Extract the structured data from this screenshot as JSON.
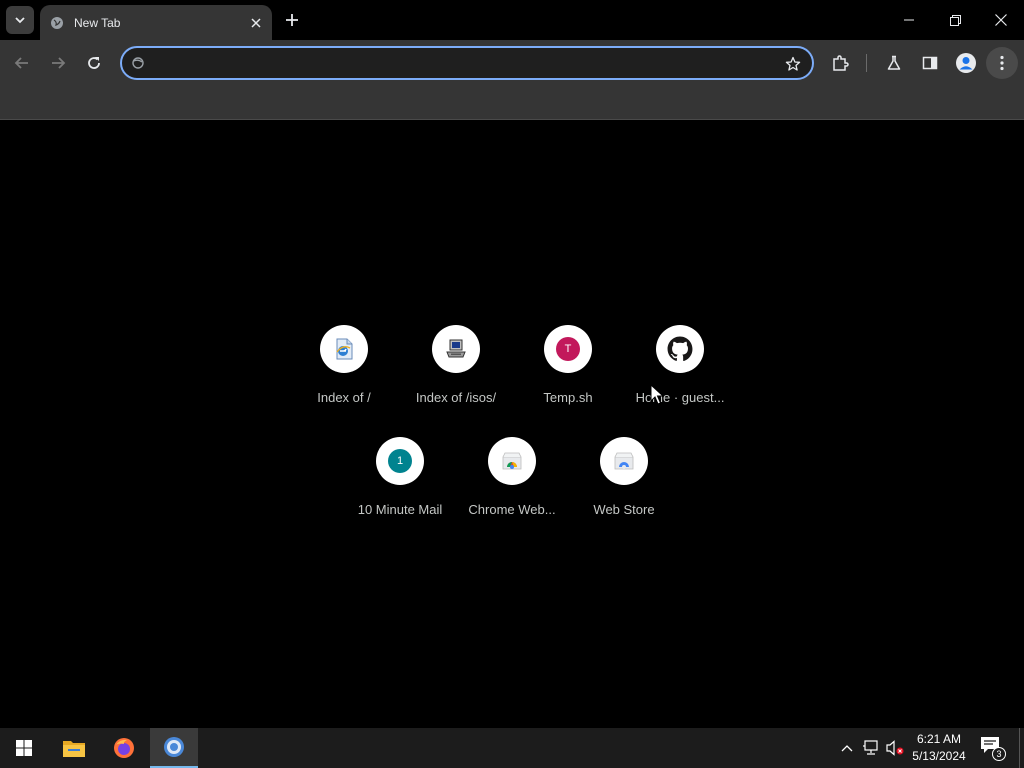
{
  "tab": {
    "title": "New Tab"
  },
  "omnibox": {
    "value": "",
    "placeholder": ""
  },
  "shortcuts": [
    {
      "label": "Index of /",
      "icon": "ie-page-icon"
    },
    {
      "label": "Index of /isos/",
      "icon": "computer-icon"
    },
    {
      "label": "Temp.sh",
      "icon": "letter-t-icon",
      "letter": "T",
      "color": "#c2185b"
    },
    {
      "label": "Home · guest...",
      "icon": "github-icon"
    },
    {
      "label": "10 Minute Mail",
      "icon": "letter-1-icon",
      "letter": "1",
      "color": "#00838f"
    },
    {
      "label": "Chrome Web...",
      "icon": "chrome-web-store-icon"
    },
    {
      "label": "Web Store",
      "icon": "web-store-icon"
    }
  ],
  "taskbar": {
    "time": "6:21 AM",
    "date": "5/13/2024",
    "notification_count": "3"
  },
  "colors": {
    "omnibox_border": "#7cacf8",
    "toolbar": "#353535",
    "taskbar_accent": "#76b9ed"
  }
}
